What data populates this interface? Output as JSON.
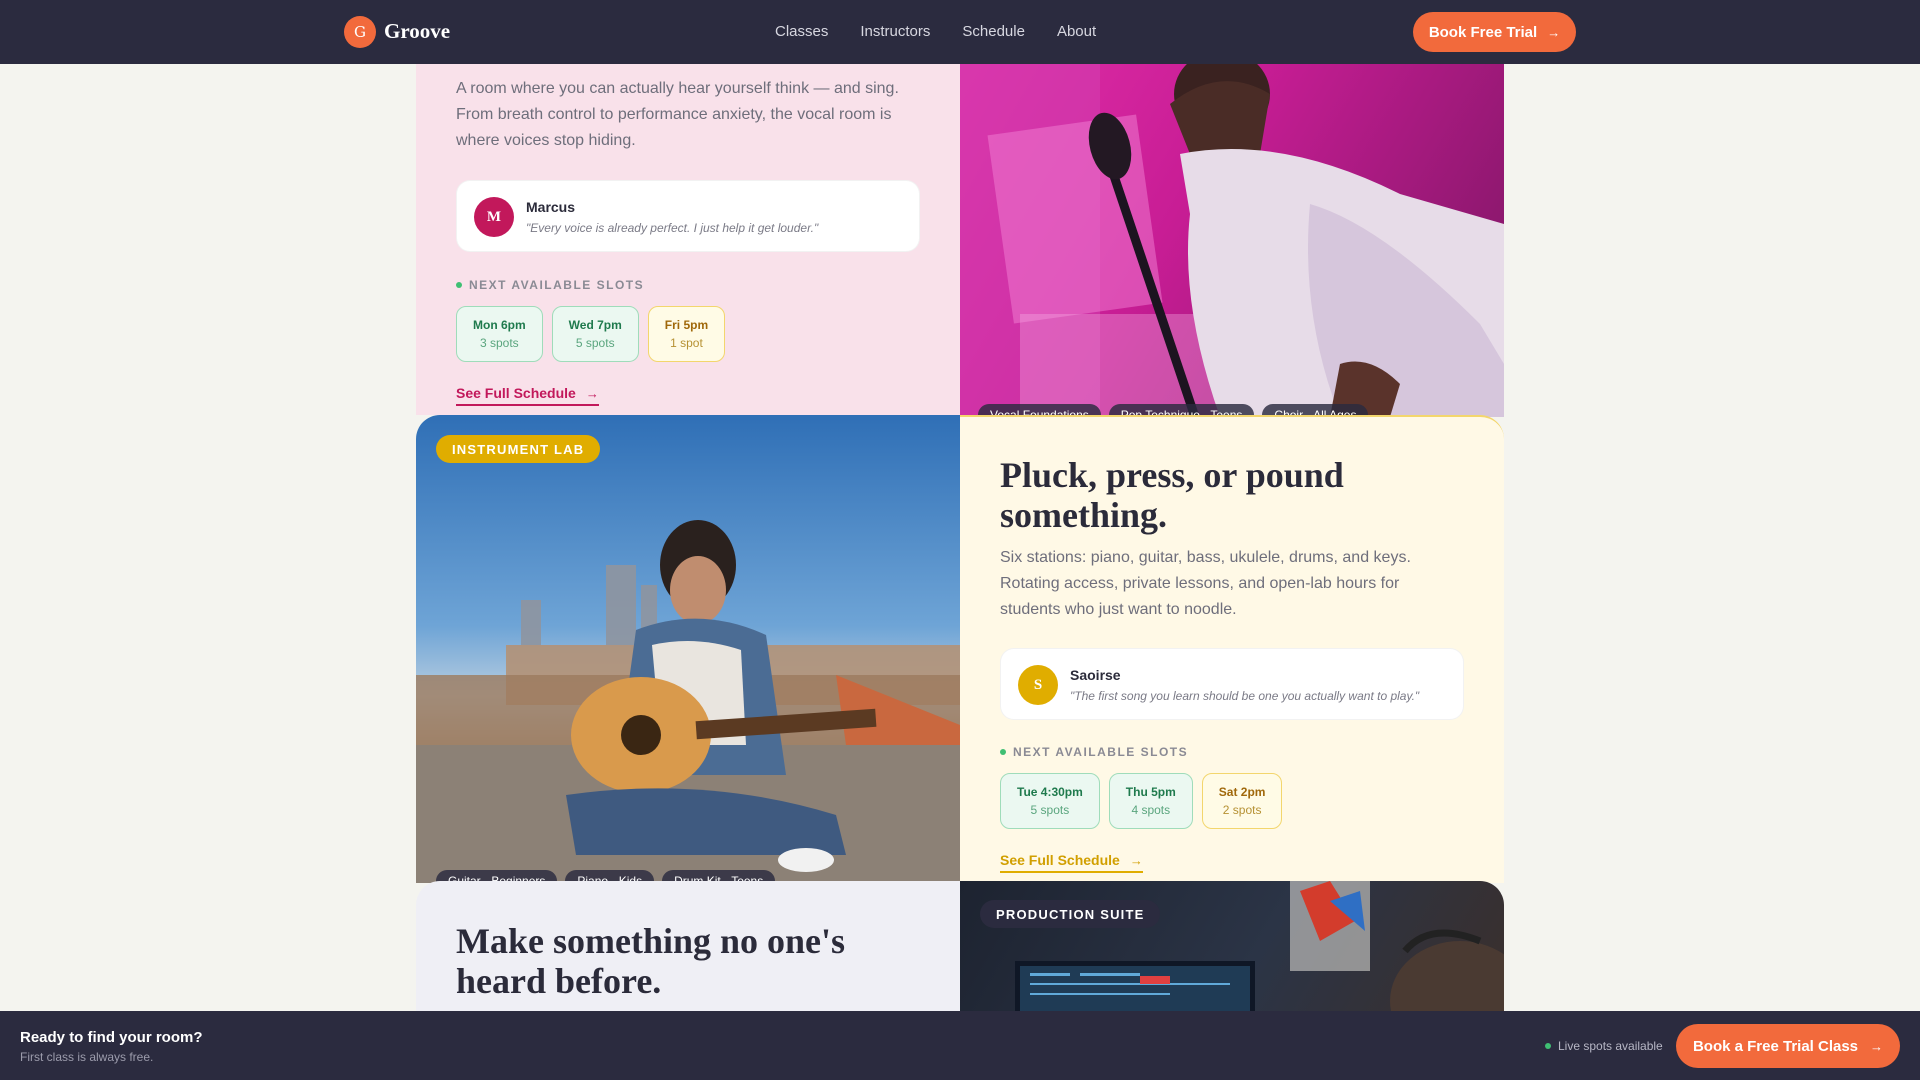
{
  "nav": {
    "logo_letter": "G",
    "brand": "Groove",
    "links": [
      "Classes",
      "Instructors",
      "Schedule",
      "About"
    ],
    "cta": "Book Free Trial"
  },
  "vocal": {
    "description": "A room where you can actually hear yourself think — and sing. From breath control to performance anxiety, the vocal room is where voices stop hiding.",
    "instructor": {
      "initial": "M",
      "name": "Marcus",
      "quote": "\"Every voice is already perfect. I just help it get louder.\""
    },
    "slots_label": "NEXT AVAILABLE SLOTS",
    "slots": [
      {
        "time": "Mon 6pm",
        "spots": "3 spots",
        "status": "green"
      },
      {
        "time": "Wed 7pm",
        "spots": "5 spots",
        "status": "green"
      },
      {
        "time": "Fri 5pm",
        "spots": "1 spot",
        "status": "yellow"
      }
    ],
    "schedule_link": "See Full Schedule",
    "tags": [
      "Vocal Foundations",
      "Pop Technique · Teens",
      "Choir · All Ages"
    ],
    "accent": "#c2185b"
  },
  "instrument": {
    "badge": "INSTRUMENT LAB",
    "title": "Pluck, press, or pound something.",
    "description": "Six stations: piano, guitar, bass, ukulele, drums, and keys. Rotating access, private lessons, and open-lab hours for students who just want to noodle.",
    "instructor": {
      "initial": "S",
      "name": "Saoirse",
      "quote": "\"The first song you learn should be one you actually want to play.\""
    },
    "slots_label": "NEXT AVAILABLE SLOTS",
    "slots": [
      {
        "time": "Tue 4:30pm",
        "spots": "5 spots",
        "status": "green"
      },
      {
        "time": "Thu 5pm",
        "spots": "4 spots",
        "status": "green"
      },
      {
        "time": "Sat 2pm",
        "spots": "2 spots",
        "status": "yellow"
      }
    ],
    "schedule_link": "See Full Schedule",
    "tags": [
      "Guitar · Beginners",
      "Piano · Kids",
      "Drum Kit · Teens"
    ],
    "accent": "#e0ad00"
  },
  "production": {
    "badge": "PRODUCTION SUITE",
    "title": "Make something no one's heard before."
  },
  "bottom_bar": {
    "title": "Ready to find your room?",
    "subtitle": "First class is always free.",
    "live": "Live spots available",
    "cta": "Book a Free Trial Class"
  }
}
